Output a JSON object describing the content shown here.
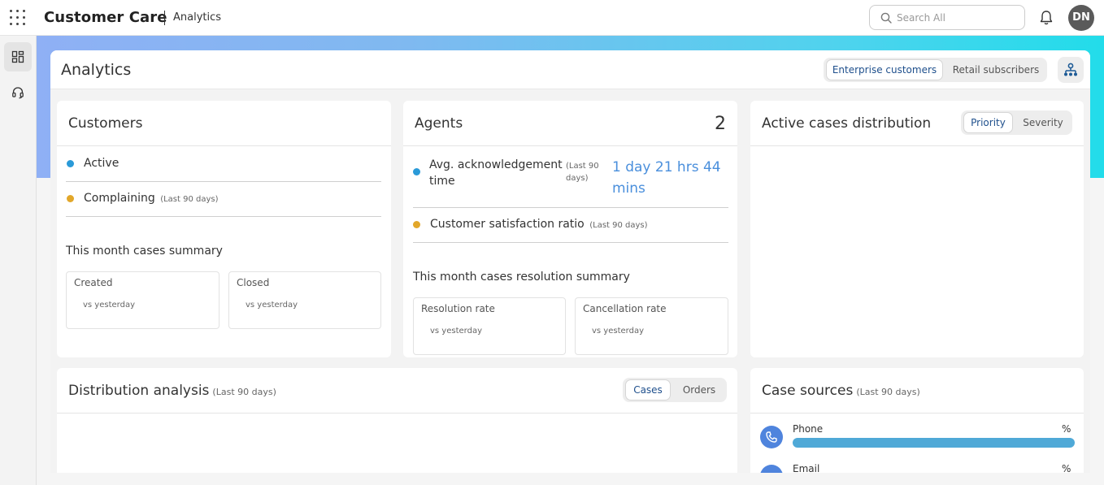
{
  "app": {
    "title": "Customer Care",
    "breadcrumb": "Analytics"
  },
  "search": {
    "placeholder": "Search All"
  },
  "user": {
    "initials": "DN"
  },
  "page": {
    "title": "Analytics",
    "segments": [
      "Enterprise customers",
      "Retail subscribers"
    ],
    "selected_segment": "Enterprise customers"
  },
  "customers": {
    "title": "Customers",
    "active_label": "Active",
    "complaining_label": "Complaining",
    "complaining_period": "(Last 90 days)",
    "summary_title": "This month cases summary",
    "created_label": "Created",
    "created_sub": "vs yesterday",
    "closed_label": "Closed",
    "closed_sub": "vs yesterday"
  },
  "agents": {
    "title": "Agents",
    "count": "2",
    "ack_label": "Avg. acknowledgement time",
    "ack_period": "(Last 90 days)",
    "ack_value": "1 day 21 hrs 44 mins",
    "csat_label": "Customer satisfaction ratio",
    "csat_period": "(Last 90 days)",
    "summary_title": "This month cases resolution summary",
    "resolution_label": "Resolution rate",
    "resolution_sub": "vs yesterday",
    "cancellation_label": "Cancellation rate",
    "cancellation_sub": "vs yesterday"
  },
  "distribution_card": {
    "title": "Active cases distribution",
    "toggles": [
      "Priority",
      "Severity"
    ],
    "selected": "Priority"
  },
  "distribution_analysis": {
    "title": "Distribution analysis",
    "period": "(Last 90 days)",
    "toggles": [
      "Cases",
      "Orders"
    ],
    "selected": "Cases"
  },
  "case_sources": {
    "title": "Case sources",
    "period": "(Last 90 days)",
    "items": [
      {
        "name": "Phone",
        "value_label": "%",
        "icon": "phone-icon",
        "fill": 1.0
      },
      {
        "name": "Email",
        "value_label": "%",
        "icon": "email-icon"
      }
    ]
  },
  "colors": {
    "accent": "#4a8fdc",
    "dot_blue": "#2a9ad8",
    "dot_amber": "#e2a72a",
    "bar": "#4fa9d7",
    "banner_start": "#8fb0f5",
    "banner_end": "#22dcea"
  }
}
